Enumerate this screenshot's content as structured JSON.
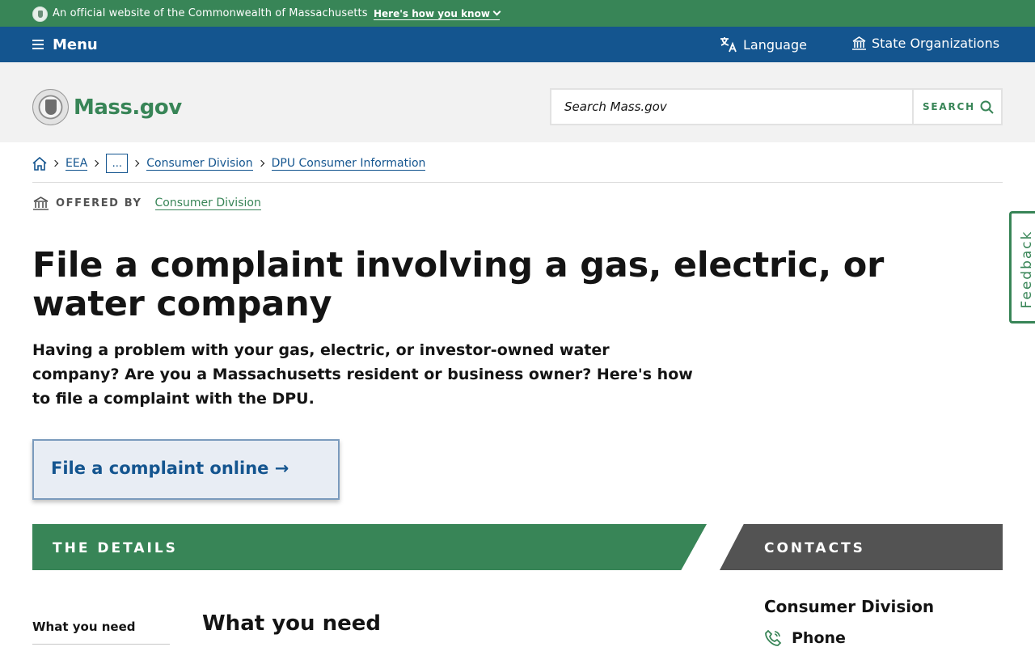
{
  "official_banner": {
    "text": "An official website of the Commonwealth of Massachusetts",
    "how_you_know": "Here's how you know"
  },
  "navbar": {
    "menu_label": "Menu",
    "language_label": "Language",
    "state_orgs_label": "State Organizations"
  },
  "header": {
    "logo_text": "Mass.gov",
    "search_placeholder": "Search Mass.gov",
    "search_button": "SEARCH"
  },
  "breadcrumb": {
    "items": [
      "EEA",
      "...",
      "Consumer Division",
      "DPU Consumer Information"
    ]
  },
  "offered_by": {
    "label": "OFFERED BY",
    "org": "Consumer Division"
  },
  "page": {
    "title": "File a complaint involving a gas, electric, or water company",
    "lede": "Having a problem with your gas, electric, or investor-owned water company? Are you a Massachusetts resident or business owner? Here's how to file a complaint with the DPU.",
    "cta_label": "File a complaint online →"
  },
  "sections": {
    "details_label": "THE DETAILS",
    "contacts_label": "CONTACTS"
  },
  "toc": {
    "item_1": "What you need"
  },
  "main": {
    "heading": "What you need"
  },
  "contact": {
    "name": "Consumer Division",
    "phone_label": "Phone"
  },
  "feedback_label": "Feedback",
  "colors": {
    "banner_green": "#388557",
    "nav_blue": "#14558f",
    "header_gray": "#f2f2f2",
    "contacts_gray": "#535353"
  },
  "icons": {
    "official_seal": "seal-icon",
    "menu": "hamburger-icon",
    "language": "translate-icon",
    "state_orgs": "building-icon",
    "search": "search-icon",
    "home": "home-icon",
    "offered_by": "building-icon",
    "phone": "phone-icon"
  }
}
